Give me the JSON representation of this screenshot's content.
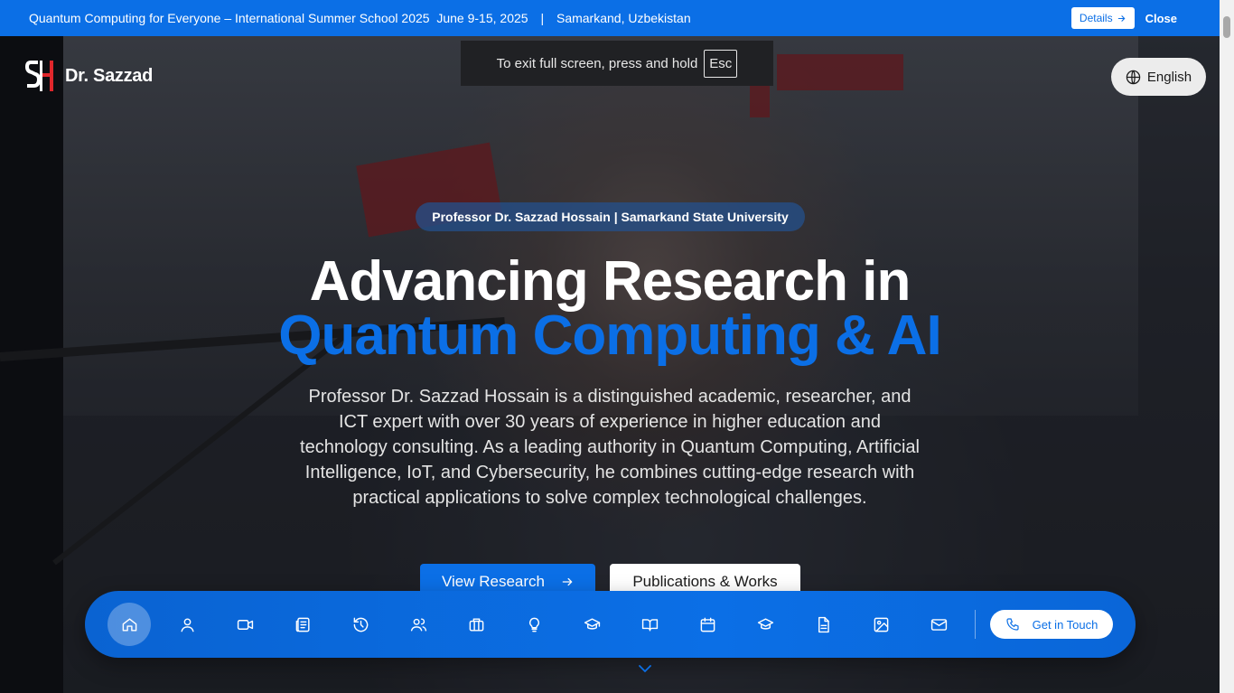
{
  "announcement": {
    "text": "Quantum Computing for Everyone – International Summer School 2025",
    "dates": "June 9-15, 2025",
    "separator": "|",
    "location": "Samarkand, Uzbekistan",
    "details_label": "Details",
    "close_label": "Close"
  },
  "fullscreen_toast": {
    "text": "To exit full screen, press and hold",
    "key": "Esc"
  },
  "logo": {
    "name": "Dr. Sazzad"
  },
  "language": {
    "label": "English"
  },
  "hero": {
    "badge": "Professor Dr. Sazzad Hossain | Samarkand State University",
    "headline_line1": "Advancing Research in",
    "headline_line2": "Quantum Computing & AI",
    "description": "Professor Dr. Sazzad Hossain is a distinguished academic, researcher, and ICT expert with over 30 years of experience in higher education and technology consulting. As a leading authority in Quantum Computing, Artificial Intelligence, IoT, and Cybersecurity, he combines cutting-edge research with practical applications to solve complex technological challenges.",
    "primary_cta": "View Research",
    "secondary_cta": "Publications & Works"
  },
  "dock": {
    "items": [
      "home-icon",
      "user-icon",
      "video-icon",
      "newspaper-icon",
      "history-icon",
      "users-icon",
      "briefcase-icon",
      "lightbulb-icon",
      "graduation-cap-icon",
      "book-open-icon",
      "calendar-icon",
      "graduation-cap-icon",
      "document-icon",
      "image-icon",
      "mail-icon"
    ],
    "active_index": 0,
    "contact_label": "Get in Touch"
  },
  "colors": {
    "accent": "#0b6fe6",
    "logo_red": "#e0262b"
  }
}
